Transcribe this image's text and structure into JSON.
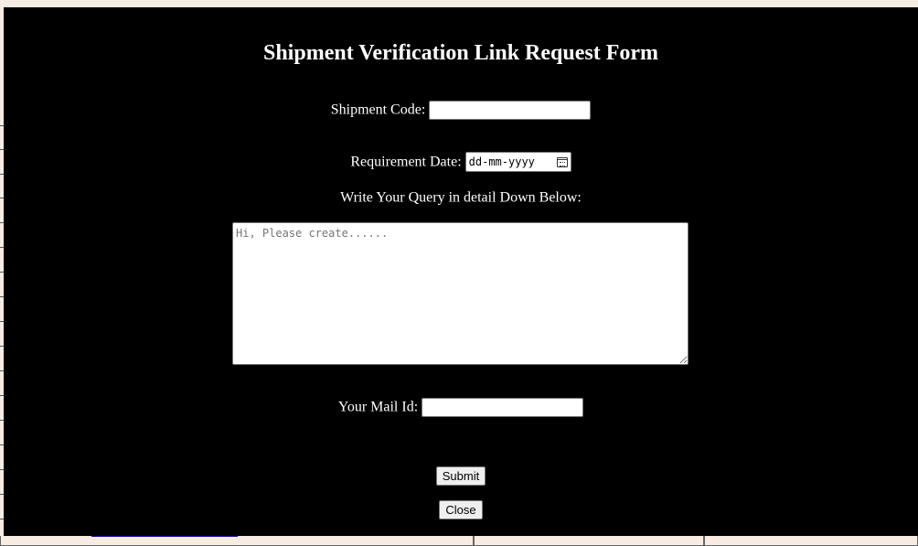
{
  "form": {
    "title": "Shipment Verification Link Request Form",
    "shipment_code": {
      "label": "Shipment Code:",
      "value": ""
    },
    "requirement_date": {
      "label": "Requirement Date:",
      "placeholder": "dd-mm-yyyy"
    },
    "query": {
      "label": "Write Your Query in detail Down Below:",
      "placeholder": "Hi, Please create......",
      "value": ""
    },
    "mail_id": {
      "label": "Your Mail Id:",
      "value": ""
    },
    "submit_label": "Submit",
    "close_label": "Close"
  },
  "icons": {
    "date_picker": "calendar-icon"
  },
  "colors": {
    "modal_background": "#000000",
    "modal_text": "#ffffff",
    "page_background": "#f7ece4"
  }
}
